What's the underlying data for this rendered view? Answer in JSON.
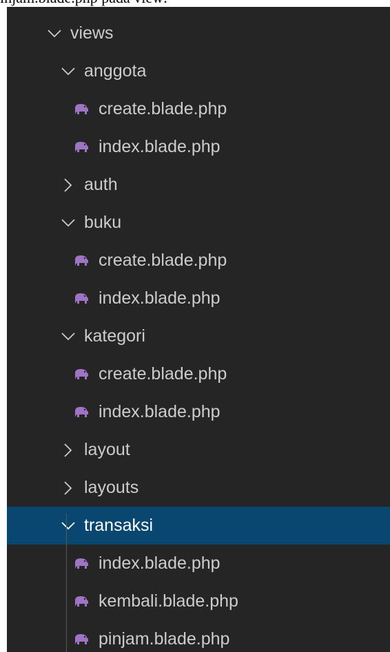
{
  "caption": "injam.blade.php pada view:",
  "colors": {
    "sidebar_bg": "#252526",
    "selected_bg": "#094771",
    "text": "#cccccc",
    "php_icon": "#a074c4"
  },
  "tree": {
    "views": {
      "label": "views",
      "expanded": true,
      "icon": "chevron-down-icon"
    },
    "anggota": {
      "label": "anggota",
      "expanded": true,
      "icon": "chevron-down-icon",
      "files": [
        {
          "label": "create.blade.php",
          "icon": "php-elephant-icon"
        },
        {
          "label": "index.blade.php",
          "icon": "php-elephant-icon"
        }
      ]
    },
    "auth": {
      "label": "auth",
      "expanded": false,
      "icon": "chevron-right-icon"
    },
    "buku": {
      "label": "buku",
      "expanded": true,
      "icon": "chevron-down-icon",
      "files": [
        {
          "label": "create.blade.php",
          "icon": "php-elephant-icon"
        },
        {
          "label": "index.blade.php",
          "icon": "php-elephant-icon"
        }
      ]
    },
    "kategori": {
      "label": "kategori",
      "expanded": true,
      "icon": "chevron-down-icon",
      "files": [
        {
          "label": "create.blade.php",
          "icon": "php-elephant-icon"
        },
        {
          "label": "index.blade.php",
          "icon": "php-elephant-icon"
        }
      ]
    },
    "layout": {
      "label": "layout",
      "expanded": false,
      "icon": "chevron-right-icon"
    },
    "layouts": {
      "label": "layouts",
      "expanded": false,
      "icon": "chevron-right-icon"
    },
    "transaksi": {
      "label": "transaksi",
      "expanded": true,
      "selected": true,
      "icon": "chevron-down-icon",
      "files": [
        {
          "label": "index.blade.php",
          "icon": "php-elephant-icon"
        },
        {
          "label": "kembali.blade.php",
          "icon": "php-elephant-icon"
        },
        {
          "label": "pinjam.blade.php",
          "icon": "php-elephant-icon"
        }
      ]
    }
  }
}
